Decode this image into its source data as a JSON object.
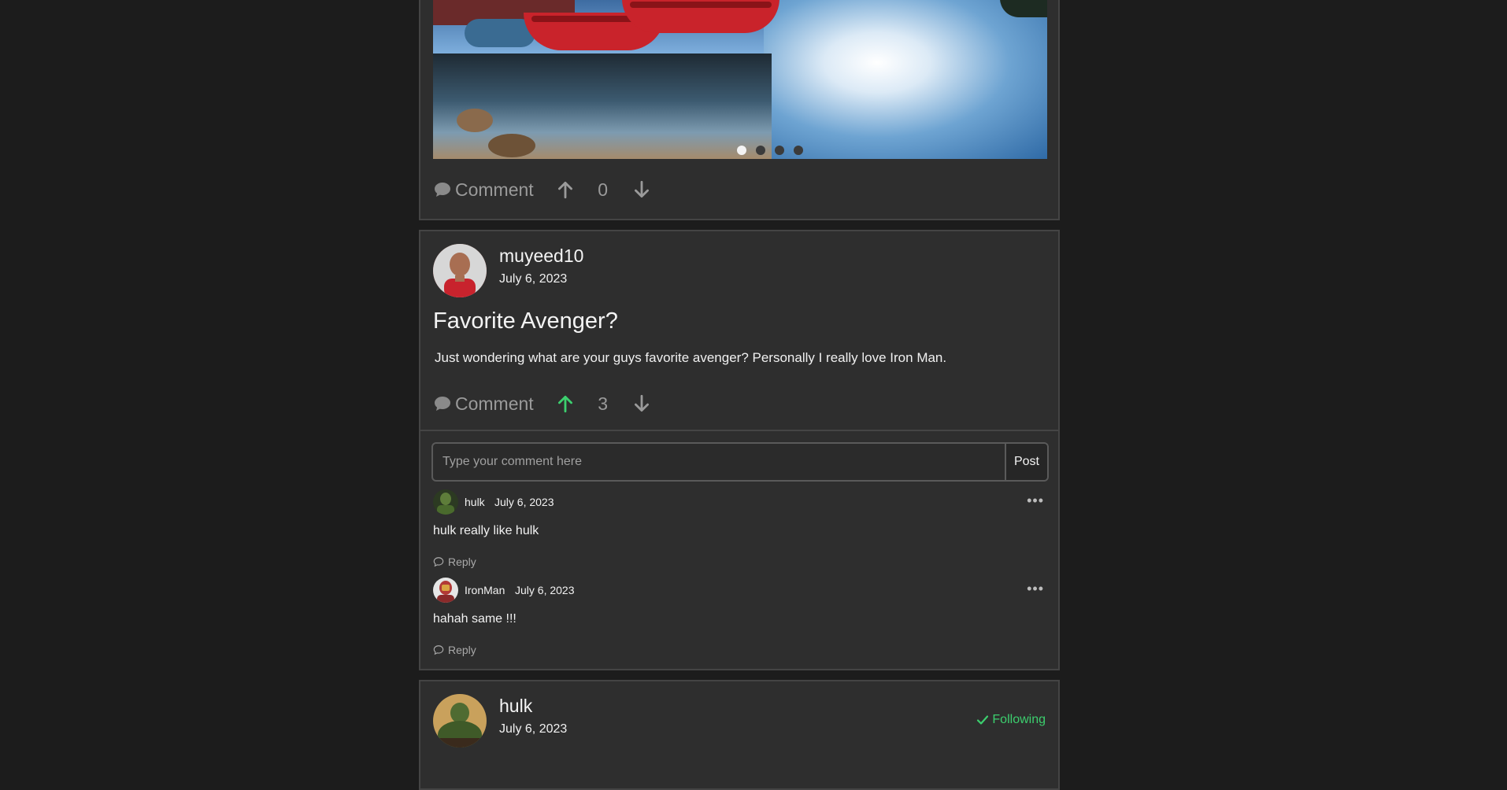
{
  "posts": [
    {
      "carousel": {
        "slide_count": 4,
        "active_index": 0
      },
      "actions": {
        "comment_label": "Comment",
        "votes": "0",
        "upvoted": false
      }
    },
    {
      "author": "muyeed10",
      "date": "July 6, 2023",
      "title": "Favorite Avenger?",
      "body": "Just wondering what are your guys favorite avenger? Personally I really love Iron Man.",
      "actions": {
        "comment_label": "Comment",
        "votes": "3",
        "upvoted": true
      },
      "comment_form": {
        "placeholder": "Type your comment here",
        "submit_label": "Post"
      },
      "comments": [
        {
          "author": "hulk",
          "date": "July 6, 2023",
          "text": "hulk really like hulk",
          "reply_label": "Reply"
        },
        {
          "author": "IronMan",
          "date": "July 6, 2023",
          "text": "hahah same !!!",
          "reply_label": "Reply"
        }
      ]
    },
    {
      "author": "hulk",
      "date": "July 6, 2023",
      "follow_label": "Following"
    }
  ],
  "colors": {
    "background": "#1c1c1c",
    "card": "#2e2e2e",
    "card_border": "#444444",
    "upvote_active": "#3ccf6e",
    "muted": "#9a9a9a",
    "following": "#3ccf6e"
  },
  "icons": {
    "comment": "speech-bubble-icon",
    "upvote": "arrow-up-icon",
    "downvote": "arrow-down-icon",
    "menu": "ellipsis-icon",
    "reply": "reply-bubble-icon",
    "following": "checkmark-icon"
  }
}
